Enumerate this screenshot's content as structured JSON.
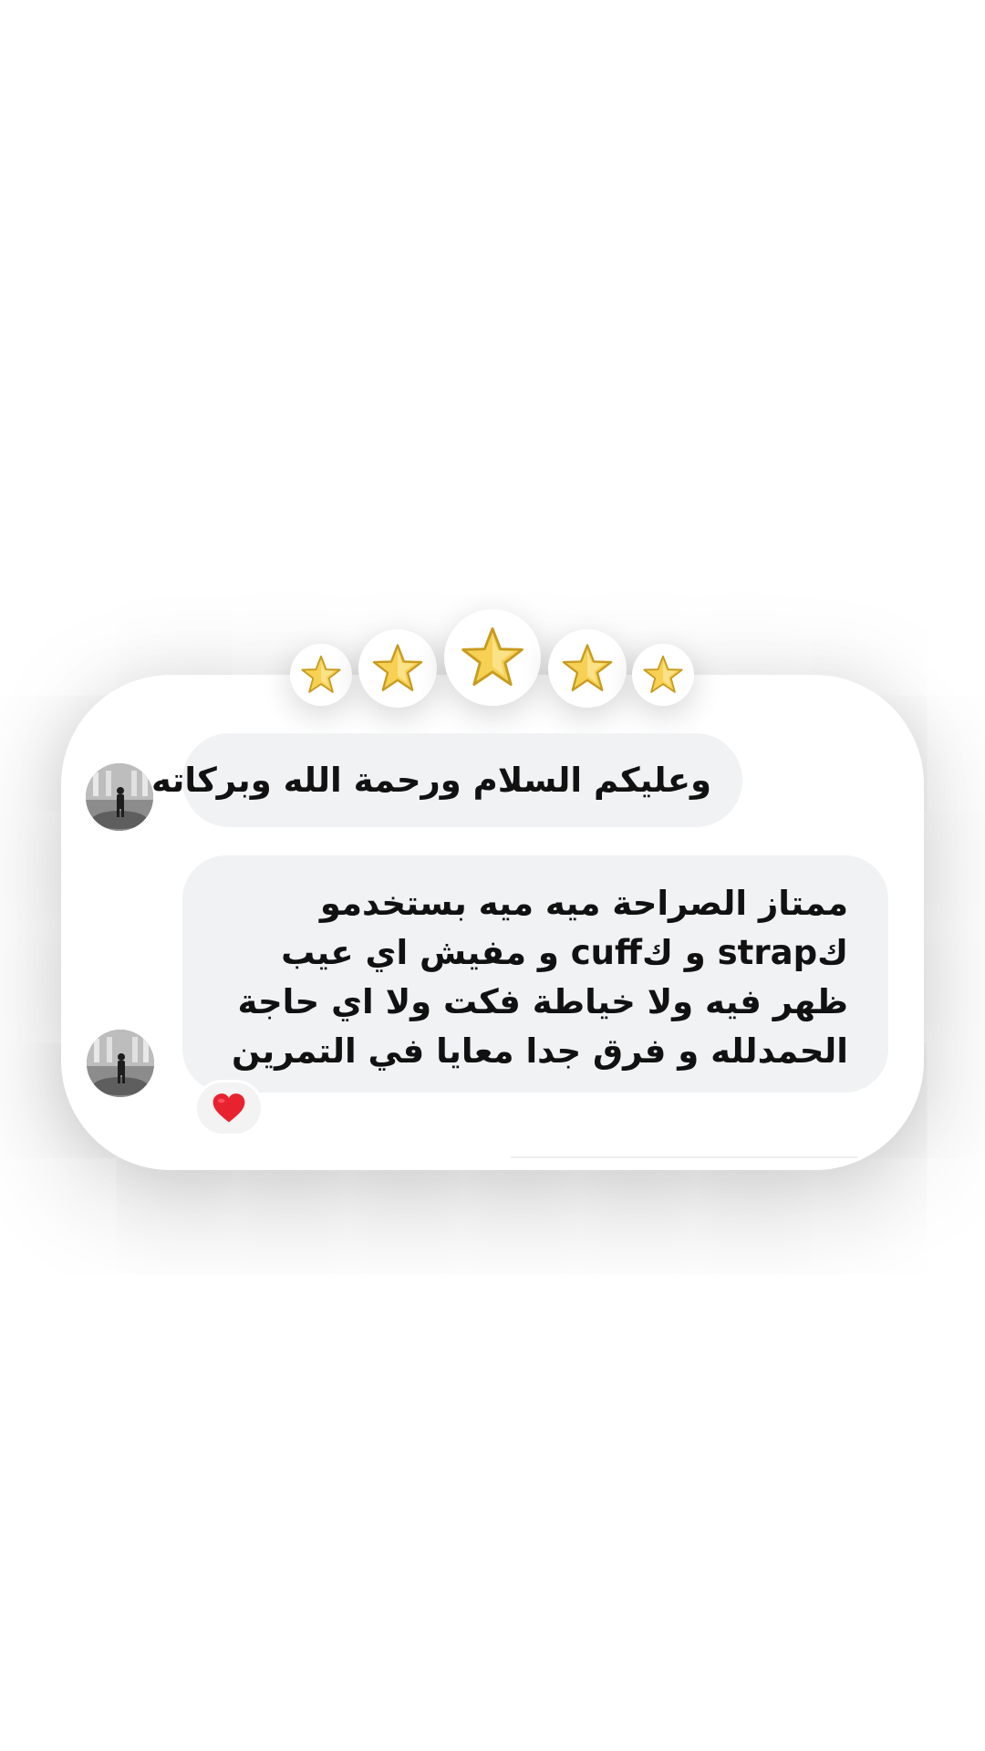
{
  "rating": {
    "stars": 5,
    "star_color": "#f7d154",
    "star_outline": "#c89b1f"
  },
  "messages": [
    {
      "sender": "avatar-user",
      "text": "وعليكم السلام ورحمة الله وبركاته"
    },
    {
      "sender": "avatar-user",
      "text": "ممتاز الصراحة ميه ميه بستخدمو كstrap و كcuff و مفيش اي عيب ظهر فيه ولا خياطة فكت ولا اي حاجة الحمدلله و فرق جدا معايا في التمرين",
      "reaction": "heart-icon",
      "reaction_color": "#e8232f"
    }
  ],
  "colors": {
    "bubble": "#f1f2f4",
    "card": "#ffffff",
    "text": "#111111"
  }
}
